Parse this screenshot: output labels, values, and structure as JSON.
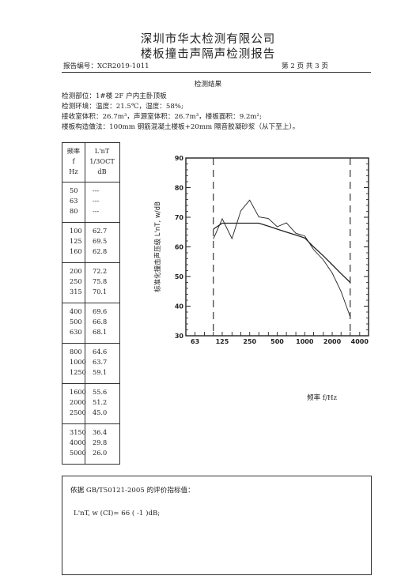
{
  "header": {
    "company": "深圳市华太检测有限公司",
    "report_title": "楼板撞击声隔声检测报告",
    "report_no": "报告编号：XCR2019-1011",
    "page_info": "第 2 页   共 3 页"
  },
  "section_title": "检测结果",
  "info": {
    "location": "检测部位：1#楼 2F 户内主卧顶板",
    "environment": "检测环境：温度：21.5℃，湿度：58%;",
    "rooms": "接收室体积：26.7m³，声源室体积：26.7m³，楼板面积：9.2m²;",
    "construction": "楼板构造做法：100mm 钢筋混凝土楼板+20mm 隔音胶凝砂浆（从下至上）。"
  },
  "table": {
    "col1_header": [
      "频率",
      "f",
      "Hz"
    ],
    "col2_header": [
      "L'nT",
      "1/3OCT",
      "dB"
    ],
    "groups": [
      {
        "freqs": [
          "50",
          "63",
          "80"
        ],
        "values": [
          "---",
          "---",
          "---"
        ]
      },
      {
        "freqs": [
          "100",
          "125",
          "160"
        ],
        "values": [
          "62.7",
          "69.5",
          "62.8"
        ]
      },
      {
        "freqs": [
          "200",
          "250",
          "315"
        ],
        "values": [
          "72.2",
          "75.8",
          "70.1"
        ]
      },
      {
        "freqs": [
          "400",
          "500",
          "630"
        ],
        "values": [
          "69.6",
          "66.8",
          "68.1"
        ]
      },
      {
        "freqs": [
          "800",
          "1000",
          "1250"
        ],
        "values": [
          "64.6",
          "63.7",
          "59.1"
        ]
      },
      {
        "freqs": [
          "1600",
          "2000",
          "2500"
        ],
        "values": [
          "55.6",
          "51.2",
          "45.0"
        ]
      },
      {
        "freqs": [
          "3150",
          "4000",
          "5000"
        ],
        "values": [
          "36.4",
          "29.8",
          "26.0"
        ]
      }
    ]
  },
  "chart_data": {
    "type": "line",
    "ylabel": "标准化撞击声压级 L'nT, w/dB",
    "xlabel": "频率 f/Hz",
    "ylim": [
      30,
      90
    ],
    "yticks": [
      30,
      40,
      50,
      60,
      70,
      80,
      90
    ],
    "x_tick_labels": [
      "63",
      "125",
      "250",
      "500",
      "1000",
      "2000",
      "4000"
    ],
    "x_tick_freqs": [
      63,
      125,
      250,
      500,
      1000,
      2000,
      4000
    ],
    "x_scale": "log",
    "dashed_markers_hz": [
      100,
      3150
    ],
    "series": [
      {
        "name": "",
        "style": "measured",
        "x": [
          100,
          125,
          160,
          200,
          250,
          315,
          400,
          500,
          630,
          800,
          1000,
          1250,
          1600,
          2000,
          2500,
          3150
        ],
        "values": [
          62.7,
          69.5,
          62.8,
          72.2,
          75.8,
          70.1,
          69.6,
          66.8,
          68.1,
          64.6,
          63.7,
          59.1,
          55.6,
          51.2,
          45.0,
          36.4
        ]
      },
      {
        "name": "",
        "style": "reference",
        "x": [
          100,
          125,
          160,
          200,
          250,
          315,
          400,
          500,
          630,
          800,
          1000,
          1250,
          1600,
          2000,
          2500,
          3150
        ],
        "values": [
          66,
          68,
          68,
          68,
          68,
          68,
          67,
          66,
          65,
          64,
          63,
          60,
          57,
          54,
          51,
          48
        ]
      }
    ]
  },
  "evaluation": {
    "label": "依据 GB/T50121-2005 的评价指标值：",
    "result": "L'nT, w (CI)= 66 ( -1 )dB;"
  }
}
